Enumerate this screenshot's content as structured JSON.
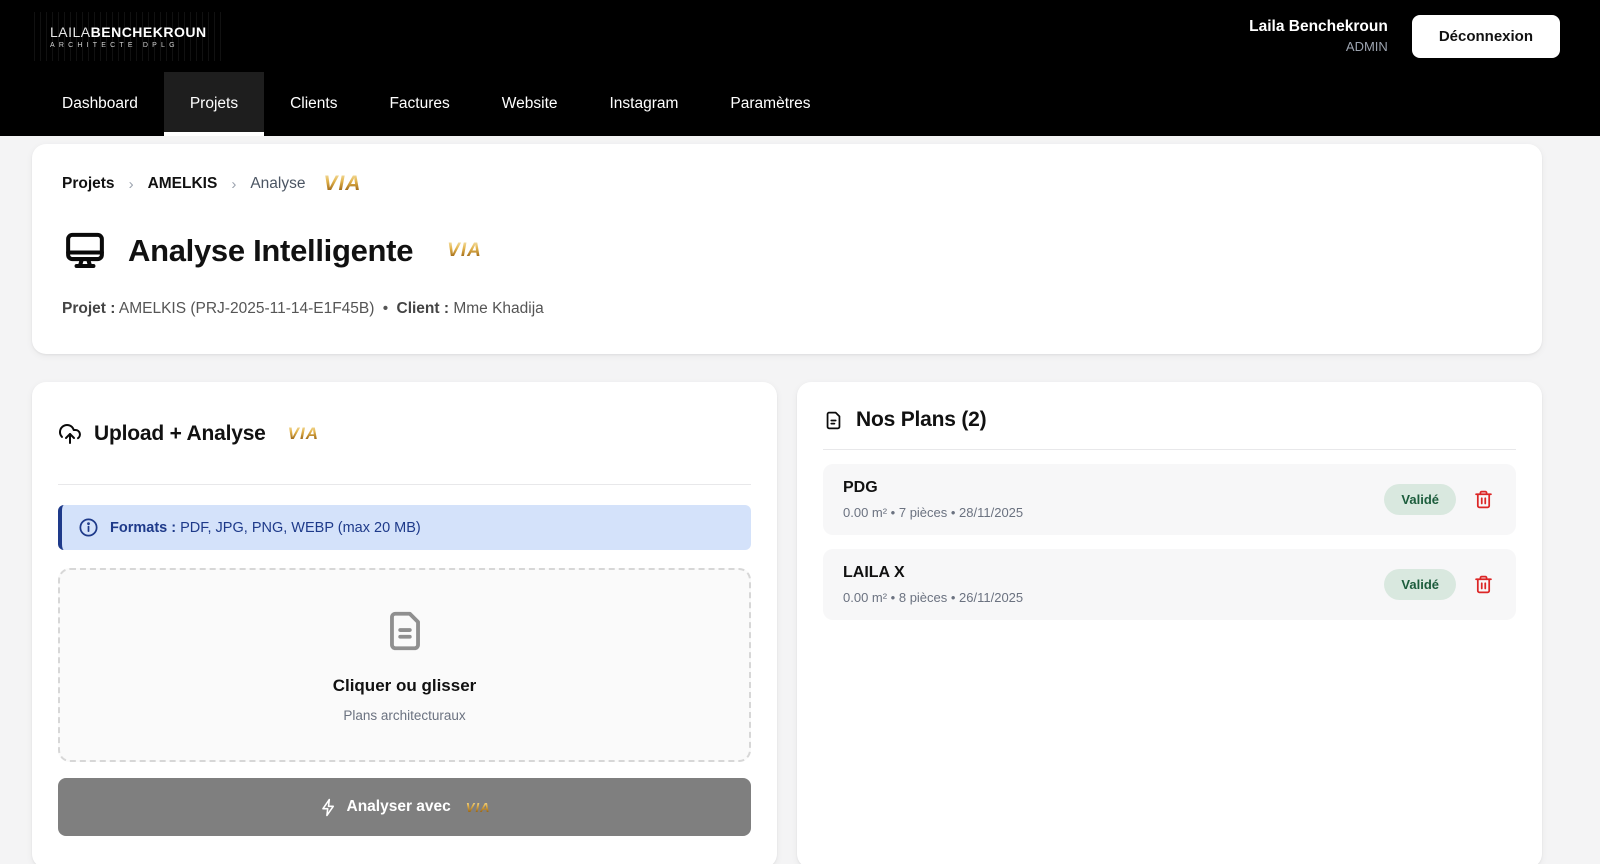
{
  "colors": {
    "gold_mid": "#d2a13c",
    "info_bg": "#d4e2fa",
    "info_text": "#1e3a8a",
    "badge_bg": "#d9e8df",
    "badge_text": "#1c5c3c",
    "danger": "#dc2626",
    "nav_bg": "#000000",
    "page_bg": "#f4f4f5"
  },
  "header": {
    "logo_line1_thin": "LAILA",
    "logo_line1_bold": "BENCHEKROUN",
    "logo_line2": "ARCHITECTE DPLG",
    "user_name": "Laila Benchekroun",
    "user_role": "ADMIN",
    "logout_label": "Déconnexion"
  },
  "nav": {
    "items": [
      {
        "label": "Dashboard",
        "active": false
      },
      {
        "label": "Projets",
        "active": true
      },
      {
        "label": "Clients",
        "active": false
      },
      {
        "label": "Factures",
        "active": false
      },
      {
        "label": "Website",
        "active": false
      },
      {
        "label": "Instagram",
        "active": false
      },
      {
        "label": "Paramètres",
        "active": false
      }
    ]
  },
  "breadcrumb": {
    "root": "Projets",
    "separator": "›",
    "project": "AMELKIS",
    "current": "Analyse",
    "via_logo": "VIA"
  },
  "title_card": {
    "title": "Analyse Intelligente",
    "via_logo": "VIA",
    "project_label": "Projet :",
    "project_value": "AMELKIS (PRJ-2025-11-14-E1F45B)",
    "separator": "•",
    "client_label": "Client :",
    "client_value": "Mme Khadija"
  },
  "upload_card": {
    "title": "Upload + Analyse",
    "via_logo": "VIA",
    "formats_label": "Formats :",
    "formats_value": "PDF, JPG, PNG, WEBP (max 20 MB)",
    "dropzone_title": "Cliquer ou glisser",
    "dropzone_subtitle": "Plans architecturaux",
    "analyze_button_label": "Analyser avec",
    "analyze_button_via": "VIA"
  },
  "plans_card": {
    "title": "Nos Plans (2)",
    "items": [
      {
        "name": "PDG",
        "meta": "0.00 m² • 7 pièces • 28/11/2025",
        "status": "Validé"
      },
      {
        "name": "LAILA X",
        "meta": "0.00 m² • 8 pièces • 26/11/2025",
        "status": "Validé"
      }
    ]
  }
}
